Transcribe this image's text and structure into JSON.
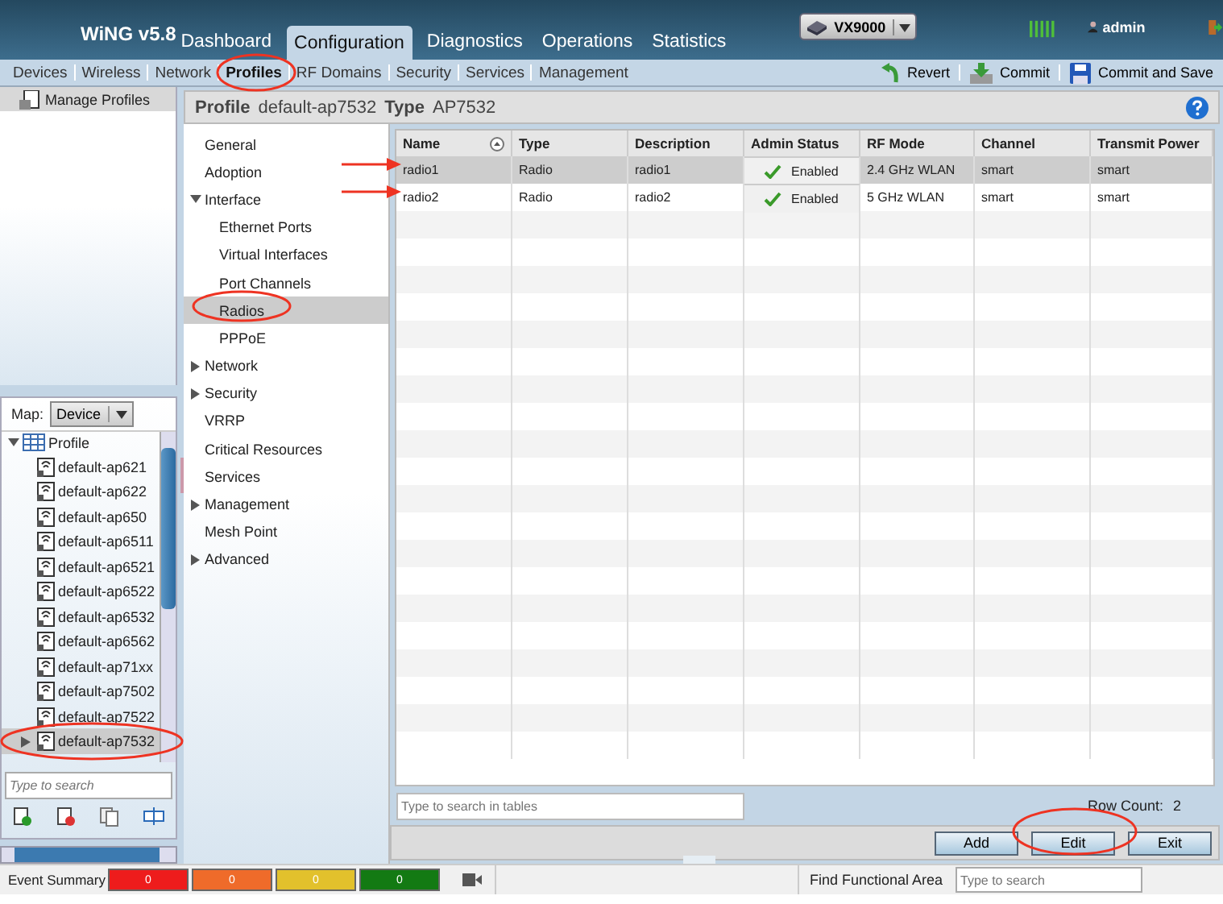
{
  "header": {
    "logo": "WiNG v5.8",
    "tabs": [
      {
        "label": "Dashboard",
        "selected": false
      },
      {
        "label": "Configuration",
        "selected": true
      },
      {
        "label": "Diagnostics",
        "selected": false
      },
      {
        "label": "Operations",
        "selected": false
      },
      {
        "label": "Statistics",
        "selected": false
      }
    ],
    "device": "VX9000",
    "user": "admin"
  },
  "subnav": {
    "items": [
      {
        "label": "Devices",
        "selected": false
      },
      {
        "label": "Wireless",
        "selected": false
      },
      {
        "label": "Network",
        "selected": false
      },
      {
        "label": "Profiles",
        "selected": true
      },
      {
        "label": "RF Domains",
        "selected": false
      },
      {
        "label": "Security",
        "selected": false
      },
      {
        "label": "Services",
        "selected": false
      },
      {
        "label": "Management",
        "selected": false
      }
    ],
    "actions": [
      {
        "kind": "revert",
        "label": "Revert"
      },
      {
        "kind": "commit",
        "label": "Commit"
      },
      {
        "kind": "save",
        "label": "Commit and Save"
      }
    ]
  },
  "sidebar": {
    "title": "Manage Profiles",
    "map_label": "Map:",
    "map_value": "Device",
    "tree": {
      "label": "Profile",
      "expanded": true,
      "children": [
        {
          "label": "default-ap621",
          "selected": false,
          "expandable": false
        },
        {
          "label": "default-ap622",
          "selected": false,
          "expandable": false
        },
        {
          "label": "default-ap650",
          "selected": false,
          "expandable": false
        },
        {
          "label": "default-ap6511",
          "selected": false,
          "expandable": false
        },
        {
          "label": "default-ap6521",
          "selected": false,
          "expandable": false
        },
        {
          "label": "default-ap6522",
          "selected": false,
          "expandable": false
        },
        {
          "label": "default-ap6532",
          "selected": false,
          "expandable": false
        },
        {
          "label": "default-ap6562",
          "selected": false,
          "expandable": false
        },
        {
          "label": "default-ap71xx",
          "selected": false,
          "expandable": false
        },
        {
          "label": "default-ap7502",
          "selected": false,
          "expandable": false
        },
        {
          "label": "default-ap7522",
          "selected": false,
          "expandable": false
        },
        {
          "label": "default-ap7532",
          "selected": true,
          "expandable": true
        }
      ]
    },
    "search": {
      "placeholder": "Type to search"
    }
  },
  "profile_bar": {
    "profile_label": "Profile",
    "profile": "default-ap7532",
    "type_label": "Type",
    "type": "AP7532"
  },
  "nav": [
    {
      "label": "General",
      "selected": false
    },
    {
      "label": "Adoption",
      "selected": false
    },
    {
      "label": "Interface",
      "selected": false,
      "expanded": true,
      "children": [
        {
          "label": "Ethernet Ports",
          "selected": false
        },
        {
          "label": "Virtual Interfaces",
          "selected": false
        },
        {
          "label": "Port Channels",
          "selected": false
        },
        {
          "label": "Radios",
          "selected": true
        },
        {
          "label": "PPPoE",
          "selected": false
        }
      ]
    },
    {
      "label": "Network",
      "selected": false,
      "expanded": false
    },
    {
      "label": "Security",
      "selected": false,
      "expanded": false
    },
    {
      "label": "VRRP",
      "selected": false
    },
    {
      "label": "Critical Resources",
      "selected": false
    },
    {
      "label": "Services",
      "selected": false
    },
    {
      "label": "Management",
      "selected": false,
      "expanded": false
    },
    {
      "label": "Mesh Point",
      "selected": false
    },
    {
      "label": "Advanced",
      "selected": false,
      "expanded": false
    }
  ],
  "table": {
    "columns": [
      "Name",
      "Type",
      "Description",
      "Admin Status",
      "RF Mode",
      "Channel",
      "Transmit Power"
    ],
    "rows": [
      {
        "selected": true,
        "enabled": true,
        "cells": [
          "radio1",
          "Radio",
          "radio1",
          "Enabled",
          "2.4 GHz WLAN",
          "smart",
          "smart"
        ]
      },
      {
        "selected": false,
        "enabled": true,
        "cells": [
          "radio2",
          "Radio",
          "radio2",
          "Enabled",
          "5 GHz WLAN",
          "smart",
          "smart"
        ]
      }
    ],
    "search": {
      "placeholder": "Type to search in tables"
    },
    "row_count_label": "Row Count:",
    "row_count": "2"
  },
  "buttons": [
    "Add",
    "Edit",
    "Exit"
  ],
  "status_bar": {
    "label": "Event Summary",
    "events": [
      {
        "count": "0",
        "color": "#ee1c1c"
      },
      {
        "count": "0",
        "color": "#ef6b2a"
      },
      {
        "count": "0",
        "color": "#e2c12c"
      },
      {
        "count": "0",
        "color": "#137a13"
      }
    ],
    "find_label": "Find Functional Area",
    "find": {
      "placeholder": "Type to search"
    }
  }
}
